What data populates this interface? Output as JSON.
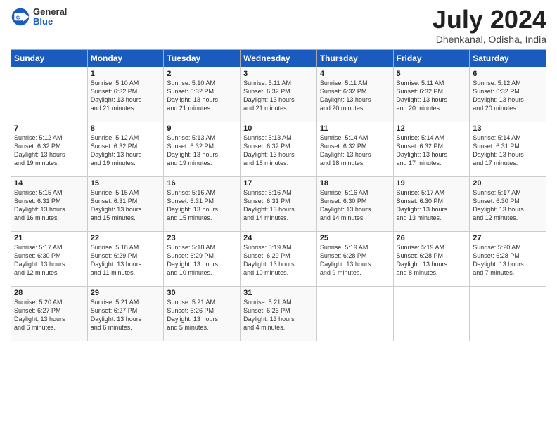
{
  "header": {
    "logo_general": "General",
    "logo_blue": "Blue",
    "month": "July 2024",
    "location": "Dhenkanal, Odisha, India"
  },
  "days_of_week": [
    "Sunday",
    "Monday",
    "Tuesday",
    "Wednesday",
    "Thursday",
    "Friday",
    "Saturday"
  ],
  "weeks": [
    [
      {
        "day": "",
        "content": ""
      },
      {
        "day": "1",
        "content": "Sunrise: 5:10 AM\nSunset: 6:32 PM\nDaylight: 13 hours\nand 21 minutes."
      },
      {
        "day": "2",
        "content": "Sunrise: 5:10 AM\nSunset: 6:32 PM\nDaylight: 13 hours\nand 21 minutes."
      },
      {
        "day": "3",
        "content": "Sunrise: 5:11 AM\nSunset: 6:32 PM\nDaylight: 13 hours\nand 21 minutes."
      },
      {
        "day": "4",
        "content": "Sunrise: 5:11 AM\nSunset: 6:32 PM\nDaylight: 13 hours\nand 20 minutes."
      },
      {
        "day": "5",
        "content": "Sunrise: 5:11 AM\nSunset: 6:32 PM\nDaylight: 13 hours\nand 20 minutes."
      },
      {
        "day": "6",
        "content": "Sunrise: 5:12 AM\nSunset: 6:32 PM\nDaylight: 13 hours\nand 20 minutes."
      }
    ],
    [
      {
        "day": "7",
        "content": "Sunrise: 5:12 AM\nSunset: 6:32 PM\nDaylight: 13 hours\nand 19 minutes."
      },
      {
        "day": "8",
        "content": "Sunrise: 5:12 AM\nSunset: 6:32 PM\nDaylight: 13 hours\nand 19 minutes."
      },
      {
        "day": "9",
        "content": "Sunrise: 5:13 AM\nSunset: 6:32 PM\nDaylight: 13 hours\nand 19 minutes."
      },
      {
        "day": "10",
        "content": "Sunrise: 5:13 AM\nSunset: 6:32 PM\nDaylight: 13 hours\nand 18 minutes."
      },
      {
        "day": "11",
        "content": "Sunrise: 5:14 AM\nSunset: 6:32 PM\nDaylight: 13 hours\nand 18 minutes."
      },
      {
        "day": "12",
        "content": "Sunrise: 5:14 AM\nSunset: 6:32 PM\nDaylight: 13 hours\nand 17 minutes."
      },
      {
        "day": "13",
        "content": "Sunrise: 5:14 AM\nSunset: 6:31 PM\nDaylight: 13 hours\nand 17 minutes."
      }
    ],
    [
      {
        "day": "14",
        "content": "Sunrise: 5:15 AM\nSunset: 6:31 PM\nDaylight: 13 hours\nand 16 minutes."
      },
      {
        "day": "15",
        "content": "Sunrise: 5:15 AM\nSunset: 6:31 PM\nDaylight: 13 hours\nand 15 minutes."
      },
      {
        "day": "16",
        "content": "Sunrise: 5:16 AM\nSunset: 6:31 PM\nDaylight: 13 hours\nand 15 minutes."
      },
      {
        "day": "17",
        "content": "Sunrise: 5:16 AM\nSunset: 6:31 PM\nDaylight: 13 hours\nand 14 minutes."
      },
      {
        "day": "18",
        "content": "Sunrise: 5:16 AM\nSunset: 6:30 PM\nDaylight: 13 hours\nand 14 minutes."
      },
      {
        "day": "19",
        "content": "Sunrise: 5:17 AM\nSunset: 6:30 PM\nDaylight: 13 hours\nand 13 minutes."
      },
      {
        "day": "20",
        "content": "Sunrise: 5:17 AM\nSunset: 6:30 PM\nDaylight: 13 hours\nand 12 minutes."
      }
    ],
    [
      {
        "day": "21",
        "content": "Sunrise: 5:17 AM\nSunset: 6:30 PM\nDaylight: 13 hours\nand 12 minutes."
      },
      {
        "day": "22",
        "content": "Sunrise: 5:18 AM\nSunset: 6:29 PM\nDaylight: 13 hours\nand 11 minutes."
      },
      {
        "day": "23",
        "content": "Sunrise: 5:18 AM\nSunset: 6:29 PM\nDaylight: 13 hours\nand 10 minutes."
      },
      {
        "day": "24",
        "content": "Sunrise: 5:19 AM\nSunset: 6:29 PM\nDaylight: 13 hours\nand 10 minutes."
      },
      {
        "day": "25",
        "content": "Sunrise: 5:19 AM\nSunset: 6:28 PM\nDaylight: 13 hours\nand 9 minutes."
      },
      {
        "day": "26",
        "content": "Sunrise: 5:19 AM\nSunset: 6:28 PM\nDaylight: 13 hours\nand 8 minutes."
      },
      {
        "day": "27",
        "content": "Sunrise: 5:20 AM\nSunset: 6:28 PM\nDaylight: 13 hours\nand 7 minutes."
      }
    ],
    [
      {
        "day": "28",
        "content": "Sunrise: 5:20 AM\nSunset: 6:27 PM\nDaylight: 13 hours\nand 6 minutes."
      },
      {
        "day": "29",
        "content": "Sunrise: 5:21 AM\nSunset: 6:27 PM\nDaylight: 13 hours\nand 6 minutes."
      },
      {
        "day": "30",
        "content": "Sunrise: 5:21 AM\nSunset: 6:26 PM\nDaylight: 13 hours\nand 5 minutes."
      },
      {
        "day": "31",
        "content": "Sunrise: 5:21 AM\nSunset: 6:26 PM\nDaylight: 13 hours\nand 4 minutes."
      },
      {
        "day": "",
        "content": ""
      },
      {
        "day": "",
        "content": ""
      },
      {
        "day": "",
        "content": ""
      }
    ]
  ]
}
